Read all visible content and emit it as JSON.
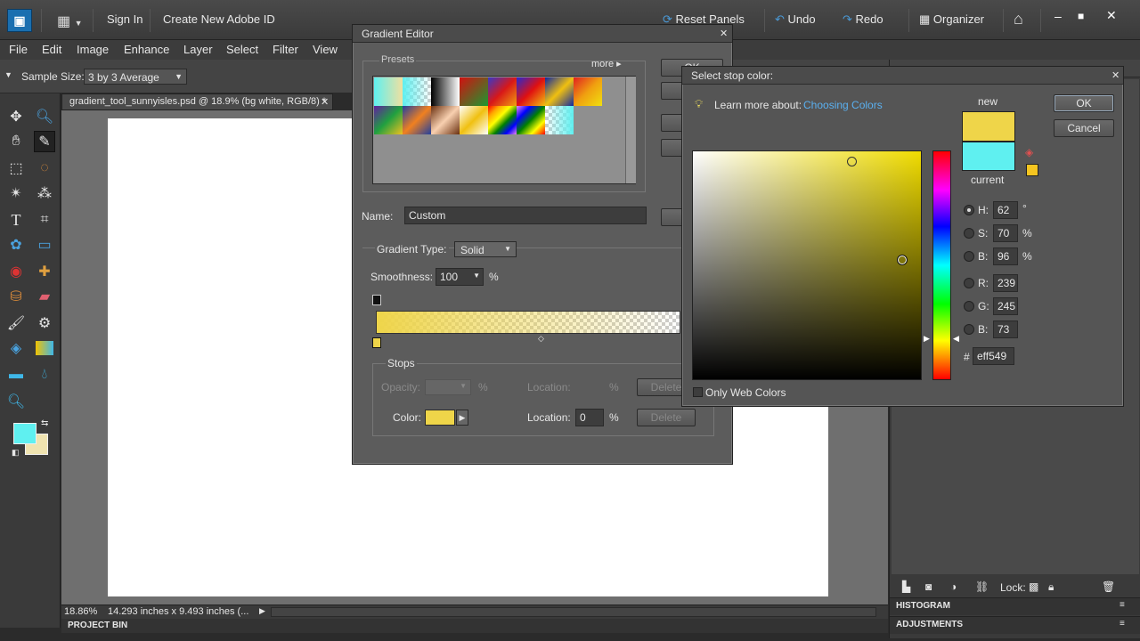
{
  "topbar": {
    "sign_in": "Sign In",
    "create_id": "Create New Adobe ID",
    "reset_panels": "Reset Panels",
    "undo": "Undo",
    "redo": "Redo",
    "organizer": "Organizer"
  },
  "menu": [
    "File",
    "Edit",
    "Image",
    "Enhance",
    "Layer",
    "Select",
    "Filter",
    "View"
  ],
  "options": {
    "sample_size_label": "Sample Size:",
    "sample_size_value": "3 by 3 Average"
  },
  "document": {
    "tab_title": "gradient_tool_sunnyisles.psd @ 18.9% (bg white, RGB/8) *",
    "zoom": "18.86%",
    "dimensions": "14.293 inches x 9.493 inches (..."
  },
  "project_bin": "PROJECT BIN",
  "right_panel": {
    "histogram": "HISTOGRAM",
    "adjustments": "ADJUSTMENTS",
    "lock_label": "Lock:"
  },
  "gradient_editor": {
    "title": "Gradient Editor",
    "presets_label": "Presets",
    "more_label": "more",
    "ok_partial": "OK",
    "name_label": "Name:",
    "name_value": "Custom",
    "gradient_type_label": "Gradient Type:",
    "gradient_type_value": "Solid",
    "smoothness_label": "Smoothness:",
    "smoothness_value": "100",
    "percent": "%",
    "stops_label": "Stops",
    "opacity_label": "Opacity:",
    "location_label": "Location:",
    "delete_label": "Delete",
    "color_label": "Color:",
    "color_location_value": "0",
    "stop_color": "#efd549"
  },
  "color_picker": {
    "title": "Select stop color:",
    "learn_more": "Learn more about:",
    "learn_link": "Choosing Colors",
    "new_label": "new",
    "current_label": "current",
    "new_color": "#efd549",
    "current_color": "#5ff0f0",
    "ok": "OK",
    "cancel": "Cancel",
    "hue_color": "#f0dc00",
    "fields": [
      {
        "key": "H:",
        "value": "62",
        "unit": "°",
        "selected": true
      },
      {
        "key": "S:",
        "value": "70",
        "unit": "%",
        "selected": false
      },
      {
        "key": "B:",
        "value": "96",
        "unit": "%",
        "selected": false
      },
      {
        "key": "R:",
        "value": "239",
        "unit": "",
        "selected": false
      },
      {
        "key": "G:",
        "value": "245",
        "unit": "",
        "selected": false
      },
      {
        "key": "B:",
        "value": "73",
        "unit": "",
        "selected": false
      }
    ],
    "hex_label": "#",
    "hex_value": "eff549",
    "web_colors": "Only Web Colors"
  }
}
